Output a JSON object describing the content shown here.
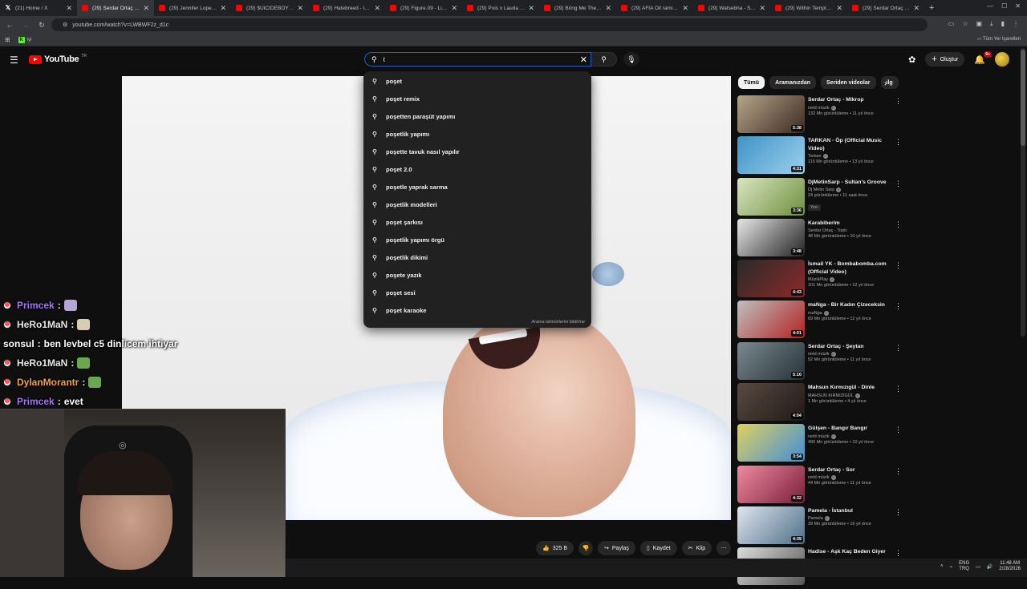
{
  "browser": {
    "tabs": [
      {
        "title": "(21) Home / X",
        "icon": "x-logo"
      },
      {
        "title": "(29) Serdar Ortaç - Po",
        "icon": "youtube",
        "active": true
      },
      {
        "title": "(29) Jennifer Lopez - A",
        "icon": "youtube"
      },
      {
        "title": "(29) $UICIDEBOY$ - N",
        "icon": "youtube"
      },
      {
        "title": "(29) Hatebreed - I Will",
        "icon": "youtube"
      },
      {
        "title": "(29) Figure.09 - Linkin",
        "icon": "youtube"
      },
      {
        "title": "(29) Pois x Lauda - Tek",
        "icon": "youtube"
      },
      {
        "title": "(29) Bring Me The Hor",
        "icon": "youtube"
      },
      {
        "title": "(29) AFIA Oil rami org",
        "icon": "youtube"
      },
      {
        "title": "(29) Watsebha - Soul",
        "icon": "youtube"
      },
      {
        "title": "(29) Within Temptation",
        "icon": "youtube"
      },
      {
        "title": "(29) Serdar Ortaç ft. E",
        "icon": "youtube"
      }
    ],
    "url": "youtube.com/watch?v=LWBWF2z_d1c",
    "bookmarks": {
      "kick_label": "iyi",
      "all_bookmarks": "Tüm Yer İşaretleri"
    }
  },
  "youtube": {
    "logo_text": "YouTube",
    "logo_country": "TR",
    "search_value": "t",
    "create_label": "Oluştur",
    "notif_count": "9+",
    "suggestions": [
      "poşet",
      "poşet remix",
      "poşetten paraşüt yapımı",
      "poşetlik yapımı",
      "poşette tavuk nasıl yapılır",
      "poşet 2.0",
      "poşetle yaprak sarma",
      "poşetlik modelleri",
      "poşet şarkısı",
      "poşetlik yapımı örgü",
      "poşetlik dikimi",
      "poşete yazık",
      "poşet sesi",
      "poşet karaoke"
    ],
    "suggestions_report": "Arama tahminlerini bildirme",
    "actions": {
      "likes": "325 B",
      "share": "Paylaş",
      "save": "Kaydet",
      "clip": "Klip"
    },
    "chips": [
      "Tümü",
      "Aramanızdan",
      "Seriden videolar",
      "ilg"
    ],
    "recommendations": [
      {
        "title": "Serdar Ortaç - Mikrop",
        "channel": "netd müzik",
        "verified": true,
        "meta": "132 Mn görüntüleme • 11 yıl önce",
        "duration": "5:38",
        "colors": [
          "#b7a589",
          "#3a2a22"
        ]
      },
      {
        "title": "TARKAN - Öp (Official Music Video)",
        "channel": "Tarkan",
        "verified": true,
        "meta": "115 Mn görüntüleme • 13 yıl önce",
        "duration": "4:31",
        "colors": [
          "#3f93c7",
          "#9bd0ec"
        ]
      },
      {
        "title": "DjMetinSarp - Sultan's Groove",
        "channel": "Dj Metin Sarp",
        "verified": true,
        "meta": "24 görüntüleme • 11 saat önce",
        "duration": "3:36",
        "badge": "Yeni",
        "colors": [
          "#d9e6c1",
          "#6e8e3c"
        ]
      },
      {
        "title": "Karabiberim",
        "channel": "Serdar Ortaç - Topic",
        "verified": false,
        "meta": "48 Mn görüntüleme • 10 yıl önce",
        "duration": "3:48",
        "colors": [
          "#e7e7e7",
          "#222222"
        ]
      },
      {
        "title": "İsmail YK - Bombabomba.com (Official Video)",
        "channel": "MüzikPlay",
        "verified": true,
        "meta": "101 Mn görüntüleme • 12 yıl önce",
        "duration": "4:43",
        "colors": [
          "#2a2a2a",
          "#8c2a2a"
        ]
      },
      {
        "title": "maNga - Bir Kadın Çizeceksin",
        "channel": "maNga",
        "verified": true,
        "meta": "69 Mn görüntüleme • 12 yıl önce",
        "duration": "4:01",
        "colors": [
          "#c0c0c0",
          "#b22222"
        ]
      },
      {
        "title": "Serdar Ortaç - Şeytan",
        "channel": "netd müzik",
        "verified": true,
        "meta": "52 Mn görüntüleme • 11 yıl önce",
        "duration": "5:10",
        "colors": [
          "#7a8a90",
          "#263238"
        ]
      },
      {
        "title": "Mahsun Kırmızıgül - Dinle",
        "channel": "MAHSUN KIRMIZIGÜL",
        "verified": true,
        "meta": "1 Mn görüntüleme • 4 yıl önce",
        "duration": "4:04",
        "colors": [
          "#5a4a40",
          "#1e1a18"
        ]
      },
      {
        "title": "Gülşen - Bangır Bangır",
        "channel": "netd müzik",
        "verified": true,
        "meta": "495 Mn görüntüleme • 10 yıl önce",
        "duration": "3:54",
        "colors": [
          "#e0d060",
          "#3f8fd6"
        ]
      },
      {
        "title": "Serdar Ortaç - Sor",
        "channel": "netd müzik",
        "verified": true,
        "meta": "44 Mn görüntüleme • 11 yıl önce",
        "duration": "4:32",
        "colors": [
          "#f08aa0",
          "#7a1f3a"
        ]
      },
      {
        "title": "Pamela - İstanbul",
        "channel": "Pamela",
        "verified": true,
        "meta": "39 Mn görüntüleme • 16 yıl önce",
        "duration": "4:39",
        "colors": [
          "#dfe6ee",
          "#4e6e88"
        ]
      },
      {
        "title": "Hadise - Aşk Kaç Beden Giyer",
        "channel": "",
        "verified": false,
        "meta": "",
        "duration": "",
        "colors": [
          "#ddd",
          "#555"
        ]
      }
    ]
  },
  "chat": [
    {
      "user": "Primcek",
      "color": "#a970ff",
      "text": "",
      "emote": "#b4a7d6"
    },
    {
      "user": "HeRo1MaN",
      "color": "#e8e8e8",
      "text": "",
      "emote": "#d9cbb3"
    },
    {
      "user": "sonsul",
      "color": "#ffffff",
      "text": "ben levbel c5 dinlicem ihtiyar",
      "nobadge": true
    },
    {
      "user": "HeRo1MaN",
      "color": "#e8e8e8",
      "text": "",
      "emote": "#6aa84f"
    },
    {
      "user": "DylanMorantr",
      "color": "#f2a23a",
      "text": "",
      "emote": "#6aa84f"
    },
    {
      "user": "Primcek",
      "color": "#a970ff",
      "text": "evet"
    }
  ],
  "taskbar": {
    "lang_top": "ENG",
    "lang_bottom": "TRQ",
    "time": "11:48 AM",
    "date": "2/28/2026"
  }
}
